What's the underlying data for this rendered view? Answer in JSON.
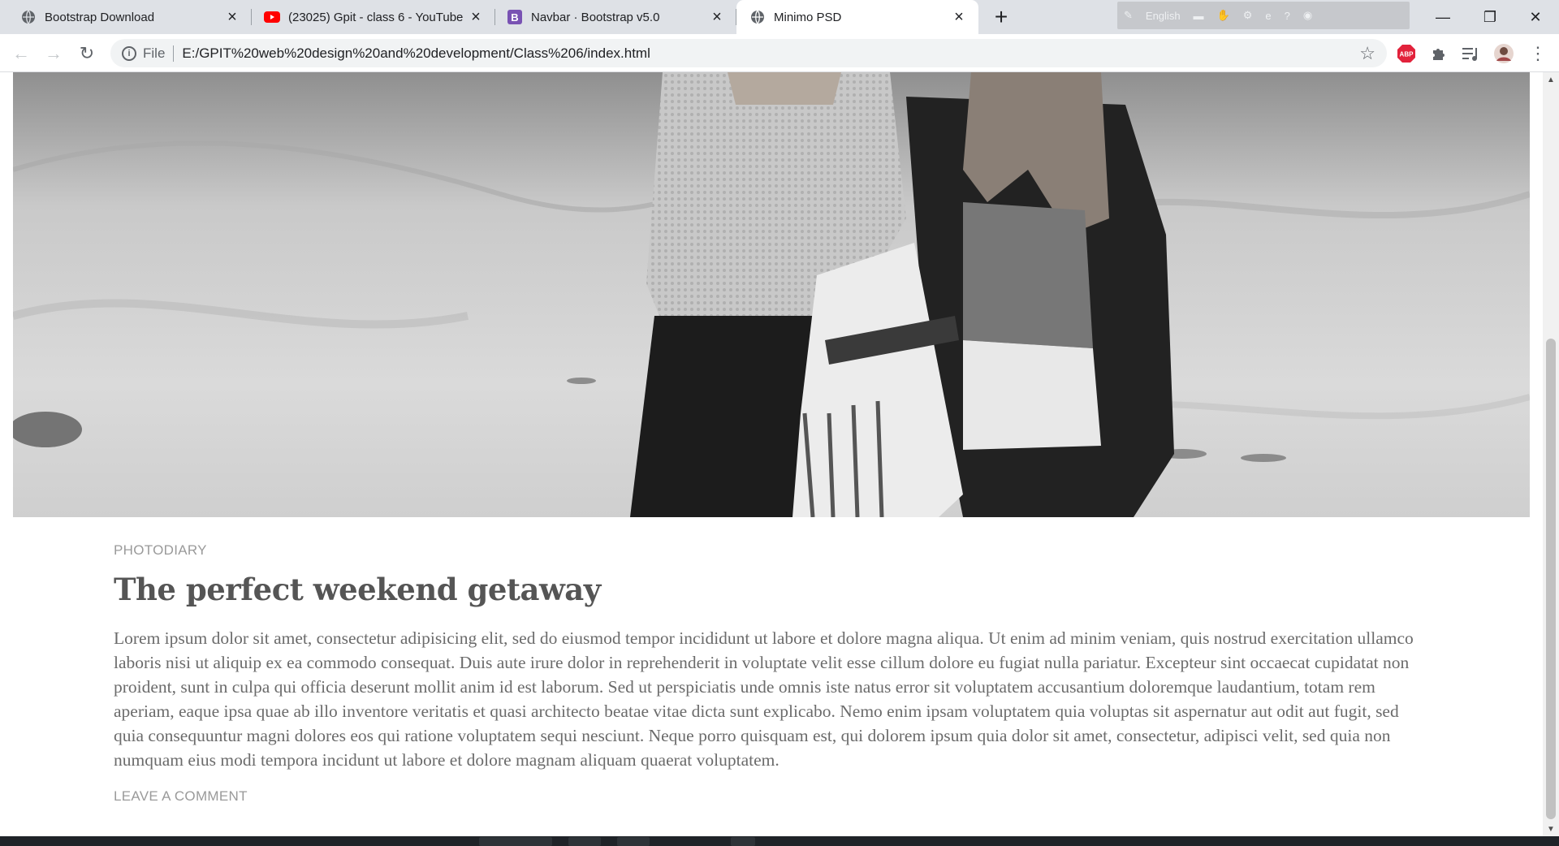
{
  "browser": {
    "tabs": [
      {
        "title": "Bootstrap Download",
        "favicon": "globe-icon",
        "active": false
      },
      {
        "title": "(23025) Gpit - class 6 - YouTube",
        "favicon": "youtube-icon",
        "active": false
      },
      {
        "title": "Navbar · Bootstrap v5.0",
        "favicon": "bootstrap-icon",
        "active": false
      },
      {
        "title": "Minimo PSD",
        "favicon": "globe-icon",
        "active": true
      }
    ],
    "language_bar": {
      "label": "English"
    },
    "address": {
      "scheme_label": "File",
      "url": "E:/GPIT%20web%20design%20and%20development/Class%206/index.html"
    },
    "extensions": [
      "abp-icon",
      "puzzle-icon",
      "reading-list-icon",
      "profile-avatar",
      "kebab-menu-icon"
    ]
  },
  "post": {
    "category": "PHOTODIARY",
    "title": "The perfect weekend getaway",
    "body": "Lorem ipsum dolor sit amet, consectetur adipisicing elit, sed do eiusmod tempor incididunt ut labore et dolore magna aliqua. Ut enim ad minim veniam, quis nostrud exercitation ullamco laboris nisi ut aliquip ex ea commodo consequat. Duis aute irure dolor in reprehenderit in voluptate velit esse cillum dolore eu fugiat nulla pariatur. Excepteur sint occaecat cupidatat non proident, sunt in culpa qui officia deserunt mollit anim id est laborum. Sed ut perspiciatis unde omnis iste natus error sit voluptatem accusantium doloremque laudantium, totam rem aperiam, eaque ipsa quae ab illo inventore veritatis et quasi architecto beatae vitae dicta sunt explicabo. Nemo enim ipsam voluptatem quia voluptas sit aspernatur aut odit aut fugit, sed quia consequuntur magni dolores eos qui ratione voluptatem sequi nesciunt. Neque porro quisquam est, qui dolorem ipsum quia dolor sit amet, consectetur, adipisci velit, sed quia non numquam eius modi tempora incidunt ut labore et dolore magnam aliquam quaerat voluptatem.",
    "comment_link": "LEAVE A COMMENT"
  },
  "colors": {
    "tabstrip": "#dee1e6",
    "active_tab": "#ffffff",
    "meta_text": "#9a9a9a",
    "title_text": "#555555",
    "body_text": "#6b6b6b",
    "abp_red": "#e2223b",
    "youtube_red": "#ff0000",
    "bootstrap_purple": "#7952b3"
  }
}
